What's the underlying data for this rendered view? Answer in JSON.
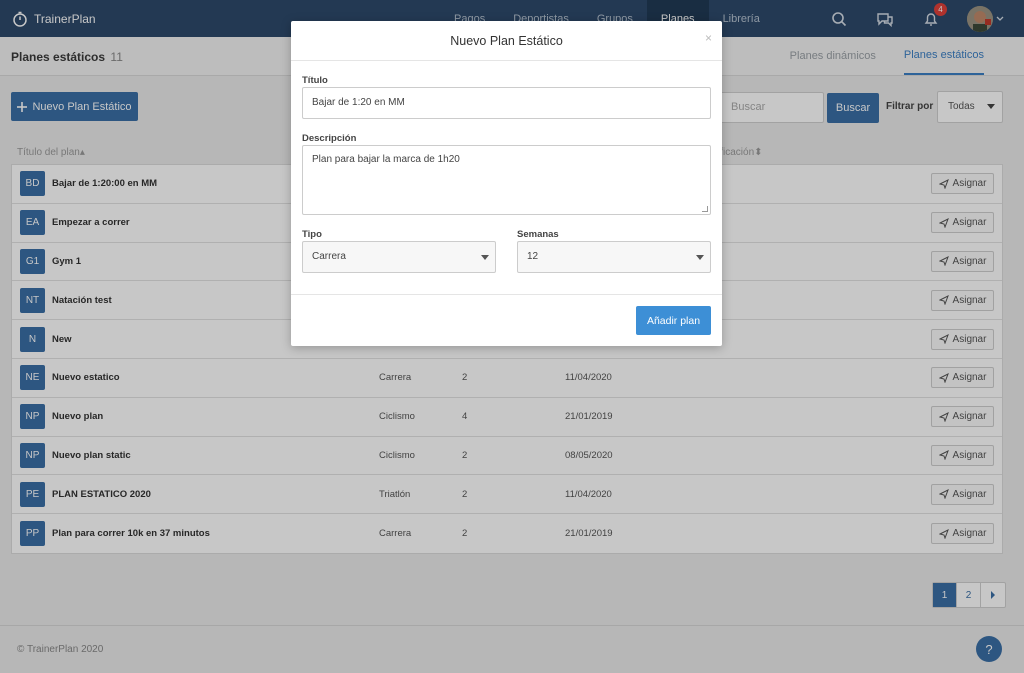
{
  "navbar": {
    "brand": "TrainerPlan",
    "items": [
      {
        "label": "Pagos"
      },
      {
        "label": "Deportistas"
      },
      {
        "label": "Grupos"
      },
      {
        "label": "Planes"
      },
      {
        "label": "Librería"
      }
    ],
    "active_item": "Planes",
    "notification_count": "4"
  },
  "page": {
    "title": "Planes estáticos",
    "count": "11",
    "subtabs": [
      {
        "label": "Planes dinámicos"
      },
      {
        "label": "Planes estáticos"
      }
    ],
    "active_subtab": "Planes estáticos"
  },
  "toolbar": {
    "new_plan_label": "Nuevo Plan Estático",
    "search_placeholder": "Buscar",
    "search_button": "Buscar",
    "filter_label": "Filtrar por",
    "filter_value": "Todas"
  },
  "table": {
    "headers": {
      "title": "Título del plan",
      "modified": "ificación"
    },
    "rows": [
      {
        "initials": "BD",
        "title": "Bajar de 1:20:00 en MM",
        "type": "",
        "weeks": "",
        "date": "",
        "action": "Asignar"
      },
      {
        "initials": "EA",
        "title": "Empezar a correr",
        "type": "",
        "weeks": "",
        "date": "",
        "action": "Asignar"
      },
      {
        "initials": "G1",
        "title": "Gym 1",
        "type": "",
        "weeks": "",
        "date": "",
        "action": "Asignar"
      },
      {
        "initials": "NT",
        "title": "Natación test",
        "type": "",
        "weeks": "",
        "date": "",
        "action": "Asignar"
      },
      {
        "initials": "N",
        "title": "New",
        "type": "",
        "weeks": "",
        "date": "",
        "action": "Asignar"
      },
      {
        "initials": "NE",
        "title": "Nuevo estatico",
        "type": "Carrera",
        "weeks": "2",
        "date": "11/04/2020",
        "action": "Asignar"
      },
      {
        "initials": "NP",
        "title": "Nuevo plan",
        "type": "Ciclismo",
        "weeks": "4",
        "date": "21/01/2019",
        "action": "Asignar"
      },
      {
        "initials": "NP",
        "title": "Nuevo plan static",
        "type": "Ciclismo",
        "weeks": "2",
        "date": "08/05/2020",
        "action": "Asignar"
      },
      {
        "initials": "PE",
        "title": "PLAN ESTATICO 2020",
        "type": "Triatlón",
        "weeks": "2",
        "date": "11/04/2020",
        "action": "Asignar"
      },
      {
        "initials": "PP",
        "title": "Plan para correr 10k en 37 minutos",
        "type": "Carrera",
        "weeks": "2",
        "date": "21/01/2019",
        "action": "Asignar"
      }
    ]
  },
  "pagination": {
    "pages": [
      "1",
      "2"
    ],
    "current": "1"
  },
  "footer": {
    "text": "© TrainerPlan 2020",
    "help": "?"
  },
  "modal": {
    "title": "Nuevo Plan Estático",
    "close": "×",
    "title_label": "Título",
    "title_value": "Bajar de 1:20 en MM",
    "description_label": "Descripción",
    "description_value": "Plan para bajar la marca de 1h20",
    "type_label": "Tipo",
    "type_value": "Carrera",
    "weeks_label": "Semanas",
    "weeks_value": "12",
    "submit_label": "Añadir plan"
  },
  "colors": {
    "navbar": "#2d4a6b",
    "primary": "#3a6fa6",
    "modal_button": "#3d8fd6",
    "badge": "#e0413a"
  }
}
